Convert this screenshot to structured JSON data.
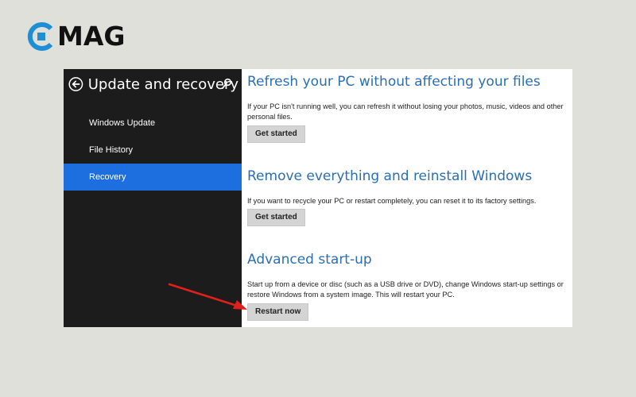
{
  "logo": {
    "text": "MAG",
    "mark_color": "#1e8fd5"
  },
  "sidebar": {
    "title": "Update and recovery",
    "items": [
      {
        "label": "Windows Update"
      },
      {
        "label": "File History"
      },
      {
        "label": "Recovery",
        "selected": true
      }
    ],
    "background": "#1c1c1c",
    "selected_color": "#1d6fe0"
  },
  "main": {
    "sections": [
      {
        "title": "Refresh your PC without affecting your files",
        "description": "If your PC isn't running well, you can refresh it without losing your photos, music, videos and other personal files.",
        "button": "Get started"
      },
      {
        "title": "Remove everything and reinstall Windows",
        "description": "If you want to recycle your PC or restart completely, you can reset it to its factory settings.",
        "button": "Get started"
      },
      {
        "title": "Advanced start-up",
        "description": "Start up from a device or disc (such as a USB drive or DVD), change Windows start-up settings or restore Windows from a system image. This will restart your PC.",
        "button": "Restart now"
      }
    ],
    "title_color": "#2b6fb2"
  },
  "annotation": {
    "icon": "red-arrow-icon",
    "color": "#e0201b"
  }
}
